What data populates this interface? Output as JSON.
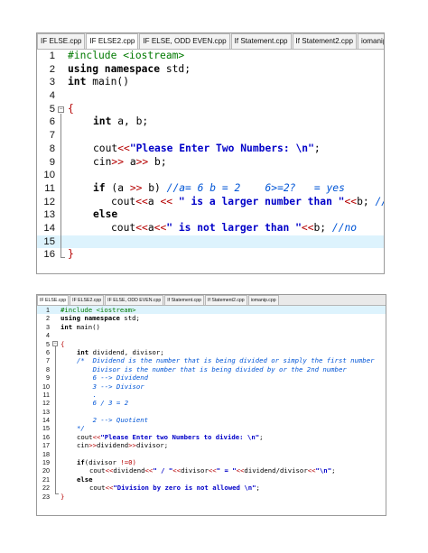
{
  "top": {
    "tabs": [
      "IF ELSE.cpp",
      "IF ELSE2.cpp",
      "IF ELSE, ODD EVEN.cpp",
      "If Statement.cpp",
      "If Statement2.cpp",
      "iomanip.cpp"
    ],
    "active_tab": 1,
    "line_numbers": [
      "1",
      "2",
      "3",
      "4",
      "5",
      "6",
      "7",
      "8",
      "9",
      "10",
      "11",
      "12",
      "13",
      "14",
      "15",
      "16"
    ],
    "code": {
      "l1": "#include <iostream>",
      "l2_kw": "using namespace",
      "l2_rest": " std;",
      "l3_kw": "int",
      "l3_rest": " main()",
      "l5": "{",
      "l6_kw": "int",
      "l6_rest": " a, b;",
      "l8_a": "cout",
      "l8_op": "<<",
      "l8_str": "\"Please Enter Two Numbers: \\n\"",
      "l8_end": ";",
      "l9_a": "cin",
      "l9_op": ">>",
      "l9_b": " a",
      "l9_op2": ">>",
      "l9_c": " b;",
      "l11_kw": "if",
      "l11_a": " (a ",
      "l11_op": ">>",
      "l11_b": " b) ",
      "l11_cm": "//a= 6 b = 2    6>=2?   = yes",
      "l12_a": "cout",
      "l12_op": "<<",
      "l12_b": "a ",
      "l12_op2": "<<",
      "l12_str": " \" is a larger number than \"",
      "l12_op3": "<<",
      "l12_c": "b; ",
      "l12_cm": "//yes",
      "l13_kw": "else",
      "l14_a": "cout",
      "l14_op": "<<",
      "l14_b": "a",
      "l14_op2": "<<",
      "l14_str": "\" is not larger than \"",
      "l14_op3": "<<",
      "l14_c": "b; ",
      "l14_cm": "//no",
      "l16": "}"
    }
  },
  "bottom": {
    "tabs": [
      "IF ELSE.cpp",
      "IF ELSE2.cpp",
      "IF ELSE, ODD EVEN.cpp",
      "If Statement.cpp",
      "If Statement2.cpp",
      "iomanip.cpp"
    ],
    "active_tab": 0,
    "line_numbers": [
      "1",
      "2",
      "3",
      "4",
      "5",
      "6",
      "7",
      "8",
      "9",
      "10",
      "11",
      "12",
      "13",
      "14",
      "15",
      "16",
      "17",
      "18",
      "19",
      "20",
      "21",
      "22",
      "23"
    ],
    "code": {
      "l1": "#include <iostream>",
      "l2_kw": "using namespace",
      "l2_rest": " std;",
      "l3_kw": "int",
      "l3_rest": " main()",
      "l5": "{",
      "l6_kw": "int",
      "l6_rest": " dividend, divisor;",
      "l7": "/*  Dividend is the number that is being divided or simply the first number",
      "l8": "    Divisor is the number that is being divided by or the 2nd number",
      "l9": "    6 --> Dividend",
      "l10": "    3 --> Divisor",
      "l11": "    .",
      "l12": "    6 / 3 = 2",
      "l14": "    2 --> Quotient",
      "l15": "*/",
      "l16_a": "cout",
      "l16_op": "<<",
      "l16_str": "\"Please Enter two Numbers to divide: \\n\"",
      "l16_end": ";",
      "l17_a": "cin",
      "l17_op": ">>",
      "l17_b": "dividend",
      "l17_op2": ">>",
      "l17_c": "divisor;",
      "l19_kw": "if",
      "l19_a": "(divisor ",
      "l19_op": "!=",
      "l19_b": "0)",
      "l20_a": "cout",
      "l20_op": "<<",
      "l20_b": "dividend",
      "l20_op2": "<<",
      "l20_str": "\" / \"",
      "l20_op3": "<<",
      "l20_c": "divisor",
      "l20_op4": "<<",
      "l20_str2": "\" = \"",
      "l20_op5": "<<",
      "l20_d": "dividend/divisor",
      "l20_op6": "<<",
      "l20_str3": "\"\\n\"",
      "l20_end": ";",
      "l21_kw": "else",
      "l22_a": "cout",
      "l22_op": "<<",
      "l22_str": "\"Division by zero is not allowed \\n\"",
      "l22_end": ";",
      "l23": "}"
    }
  }
}
